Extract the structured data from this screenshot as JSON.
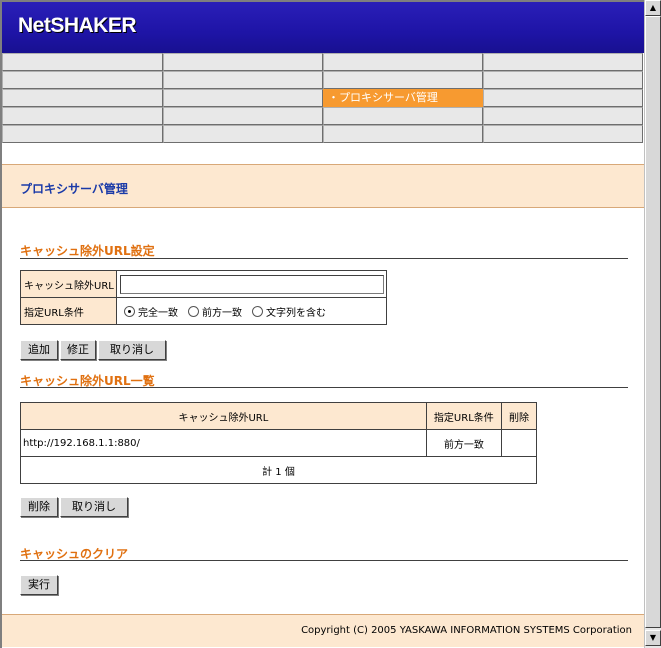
{
  "header": {
    "logo": "NetSHAKER"
  },
  "menu": {
    "rows": [
      [
        "",
        "",
        "",
        ""
      ],
      [
        "",
        "",
        "",
        ""
      ],
      [
        "",
        "",
        "・プロキシサーバ管理",
        ""
      ],
      [
        "",
        "",
        "",
        ""
      ],
      [
        "",
        "",
        "",
        ""
      ]
    ],
    "active_label": "・プロキシサーバ管理",
    "active_color": "#f79a30"
  },
  "page": {
    "title": "プロキシサーバ管理"
  },
  "exclusion_settings": {
    "title": "キャッシュ除外URL設定",
    "url_label": "キャッシュ除外URL",
    "url_value": "",
    "condition_label": "指定URL条件",
    "conditions": [
      "完全一致",
      "前方一致",
      "文字列を含む"
    ],
    "selected_condition": "完全一致"
  },
  "form_buttons": {
    "add": "追加",
    "edit": "修正",
    "cancel": "取り消し"
  },
  "exclusion_list": {
    "title": "キャッシュ除外URL一覧",
    "columns": [
      "キャッシュ除外URL",
      "指定URL条件",
      "削除"
    ],
    "rows": [
      {
        "url": "http://192.168.1.1:880/",
        "condition": "前方一致",
        "delete": ""
      }
    ],
    "total": "計 1 個"
  },
  "list_buttons": {
    "delete": "削除",
    "cancel": "取り消し"
  },
  "cache_clear": {
    "title": "キャッシュのクリア",
    "execute": "実行"
  },
  "footer": {
    "copyright": "Copyright (C) 2005 YASKAWA INFORMATION SYSTEMS Corporation"
  },
  "colors": {
    "header_bg": "#1e14a6",
    "accent_orange": "#e07010",
    "title_blue": "#1a3aa8",
    "panel_bg": "#fde8d0"
  },
  "scrollbar": {
    "up_icon": "▲",
    "down_icon": "▼"
  }
}
